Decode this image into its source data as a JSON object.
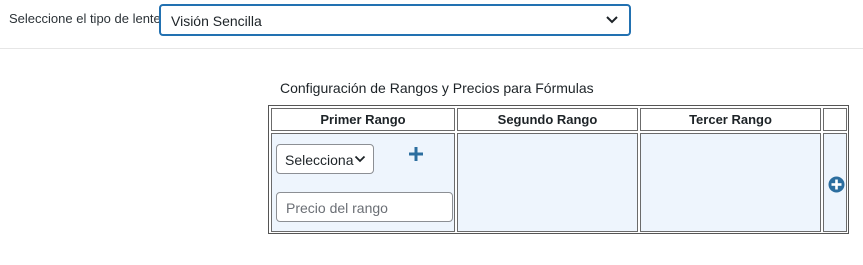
{
  "lens_type": {
    "label": "Seleccione el tipo de lentes",
    "selected": "Visión Sencilla"
  },
  "config": {
    "title": "Configuración de Rangos y Precios para Fórmulas",
    "columns": [
      "Primer Rango",
      "Segundo Rango",
      "Tercer Rango"
    ],
    "first_range": {
      "select_value": "Selecciona",
      "price_placeholder": "Precio del rango"
    }
  },
  "icons": {
    "add_condition": "plus-icon",
    "add_range": "plus-circle-icon",
    "dropdown": "chevron-down-icon"
  },
  "colors": {
    "accent": "#2271b1",
    "cell_background": "#eef5fd",
    "plus": "#2c6e9f"
  }
}
